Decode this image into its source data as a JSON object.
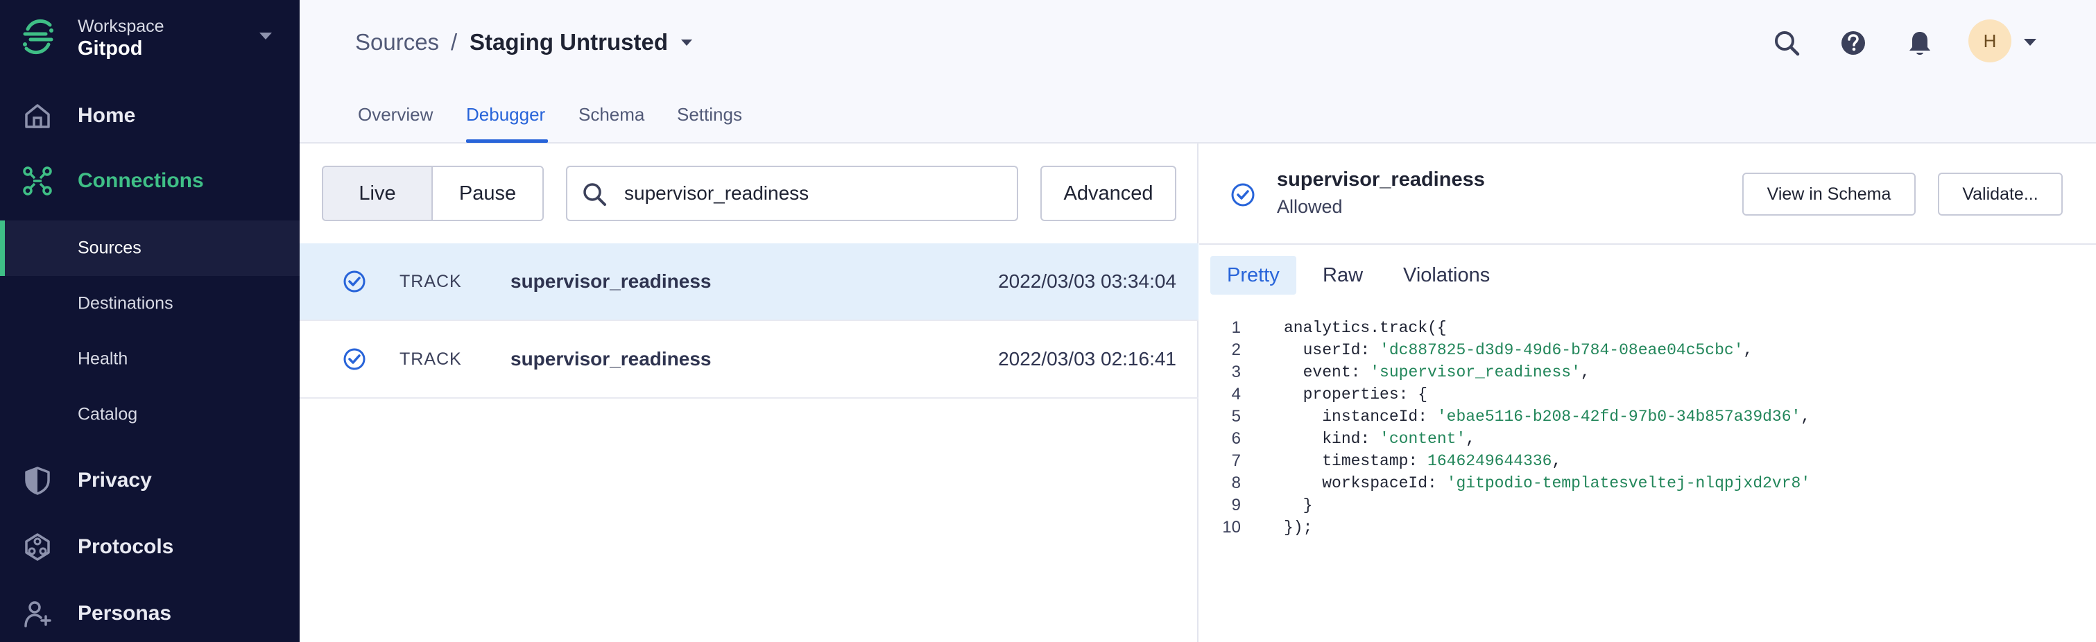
{
  "workspace": {
    "label": "Workspace",
    "name": "Gitpod",
    "logo_icon": "segment-logo-icon"
  },
  "sidebar": {
    "items": [
      {
        "label": "Home",
        "icon": "home-icon"
      },
      {
        "label": "Connections",
        "icon": "connections-icon",
        "active": true
      },
      {
        "label": "Privacy",
        "icon": "shield-icon"
      },
      {
        "label": "Protocols",
        "icon": "protocols-icon"
      },
      {
        "label": "Personas",
        "icon": "personas-icon"
      }
    ],
    "subitems": [
      {
        "label": "Sources",
        "active": true
      },
      {
        "label": "Destinations"
      },
      {
        "label": "Health"
      },
      {
        "label": "Catalog"
      }
    ],
    "accent_color": "#3fbf86",
    "background_color": "#0f1333"
  },
  "header": {
    "breadcrumb": {
      "root": "Sources",
      "separator": "/",
      "current": "Staging Untrusted"
    },
    "avatar_initial": "H",
    "icons": [
      "search-icon",
      "help-icon",
      "bell-icon"
    ],
    "tabs": [
      {
        "label": "Overview"
      },
      {
        "label": "Debugger",
        "active": true
      },
      {
        "label": "Schema"
      },
      {
        "label": "Settings"
      }
    ]
  },
  "debugger": {
    "mode_live": "Live",
    "mode_pause": "Pause",
    "search_value": "supervisor_readiness",
    "advanced_label": "Advanced",
    "events": [
      {
        "type": "TRACK",
        "name": "supervisor_readiness",
        "time": "2022/03/03 03:34:04",
        "selected": true
      },
      {
        "type": "TRACK",
        "name": "supervisor_readiness",
        "time": "2022/03/03 02:16:41"
      }
    ]
  },
  "detail": {
    "title": "supervisor_readiness",
    "status": "Allowed",
    "view_schema_label": "View in Schema",
    "validate_label": "Validate...",
    "tabs": [
      {
        "label": "Pretty",
        "active": true
      },
      {
        "label": "Raw"
      },
      {
        "label": "Violations"
      }
    ],
    "code_lines": [
      {
        "n": "1",
        "indent": "",
        "key": "analytics.track({",
        "val": "",
        "val_type": "",
        "tail": ""
      },
      {
        "n": "2",
        "indent": "  ",
        "key": "userId: ",
        "val": "'dc887825-d3d9-49d6-b784-08eae04c5cbc'",
        "val_type": "str",
        "tail": ","
      },
      {
        "n": "3",
        "indent": "  ",
        "key": "event: ",
        "val": "'supervisor_readiness'",
        "val_type": "str",
        "tail": ","
      },
      {
        "n": "4",
        "indent": "  ",
        "key": "properties: {",
        "val": "",
        "val_type": "",
        "tail": ""
      },
      {
        "n": "5",
        "indent": "    ",
        "key": "instanceId: ",
        "val": "'ebae5116-b208-42fd-97b0-34b857a39d36'",
        "val_type": "str",
        "tail": ","
      },
      {
        "n": "6",
        "indent": "    ",
        "key": "kind: ",
        "val": "'content'",
        "val_type": "str",
        "tail": ","
      },
      {
        "n": "7",
        "indent": "    ",
        "key": "timestamp: ",
        "val": "1646249644336",
        "val_type": "num",
        "tail": ","
      },
      {
        "n": "8",
        "indent": "    ",
        "key": "workspaceId: ",
        "val": "'gitpodio-templatesveltej-nlqpjxd2vr8'",
        "val_type": "str",
        "tail": ""
      },
      {
        "n": "9",
        "indent": "  ",
        "key": "}",
        "val": "",
        "val_type": "",
        "tail": ""
      },
      {
        "n": "10",
        "indent": "",
        "key": "});",
        "val": "",
        "val_type": "",
        "tail": ""
      }
    ]
  }
}
